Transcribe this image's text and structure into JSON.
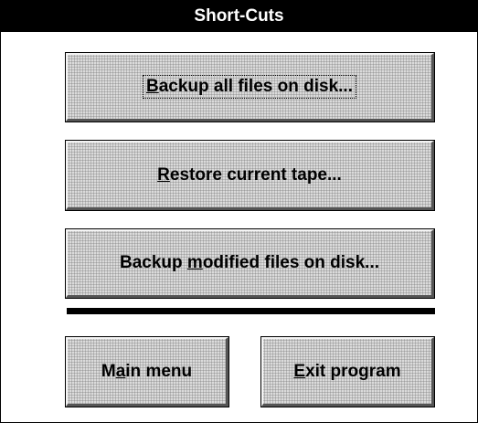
{
  "window": {
    "title": "Short-Cuts"
  },
  "buttons": {
    "backup_all": {
      "label_pre": "",
      "mnemonic": "B",
      "label_post": "ackup all files on disk..."
    },
    "restore": {
      "label_pre": "",
      "mnemonic": "R",
      "label_post": "estore current tape..."
    },
    "backup_modified": {
      "label_pre": "Backup ",
      "mnemonic": "m",
      "label_post": "odified files on disk..."
    },
    "main_menu": {
      "label_pre": "M",
      "mnemonic": "a",
      "label_post": "in menu"
    },
    "exit": {
      "label_pre": "",
      "mnemonic": "E",
      "label_post": "xit program"
    }
  },
  "colors": {
    "titlebar_bg": "#000000",
    "titlebar_fg": "#ffffff",
    "button_face": "#c8c8c8",
    "divider": "#000000"
  }
}
